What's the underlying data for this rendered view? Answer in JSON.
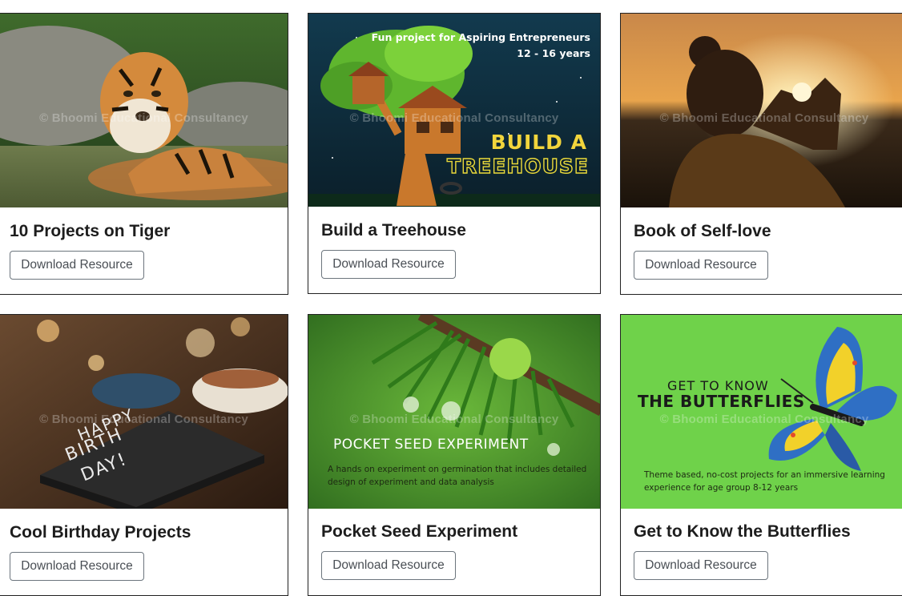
{
  "cards": [
    {
      "title": "10 Projects on Tiger",
      "button": "Download Resource",
      "watermark": "© Bhoomi Educational Consultancy",
      "image_icon": "tiger-photo"
    },
    {
      "title": "Build a Treehouse",
      "button": "Download Resource",
      "watermark": "© Bhoomi Educational Consultancy",
      "image_icon": "treehouse-illustration",
      "overlay": {
        "line1": "Fun project for Aspiring Entrepreneurs",
        "line2": "12 - 16 years",
        "heading1": "BUILD A",
        "heading2": "TREEHOUSE"
      }
    },
    {
      "title": "Book of Self-love",
      "button": "Download Resource",
      "watermark": "© Bhoomi Educational Consultancy",
      "image_icon": "sunset-heart-hands-photo"
    },
    {
      "title": "Cool Birthday Projects",
      "button": "Download Resource",
      "watermark": "© Bhoomi Educational Consultancy",
      "image_icon": "birthday-napkin-photo",
      "overlay": {
        "napkin1": "HAPPY",
        "napkin2": "BIRTH",
        "napkin3": "DAY!"
      }
    },
    {
      "title": "Pocket Seed Experiment",
      "button": "Download Resource",
      "watermark": "© Bhoomi Educational Consultancy",
      "image_icon": "pine-needles-droplets-photo",
      "overlay": {
        "heading": "POCKET SEED EXPERIMENT",
        "line1": "A hands on experiment on germination that includes detailed",
        "line2": "design of experiment and data analysis"
      }
    },
    {
      "title": "Get to Know the Butterflies",
      "button": "Download Resource",
      "watermark": "© Bhoomi Educational Consultancy",
      "image_icon": "butterfly-illustration",
      "overlay": {
        "heading1": "GET TO KNOW",
        "heading2": "THE BUTTERFLIES",
        "line1": "Theme based, no-cost projects for an immersive learning",
        "line2": "experience for age group 8-12 years"
      }
    }
  ]
}
